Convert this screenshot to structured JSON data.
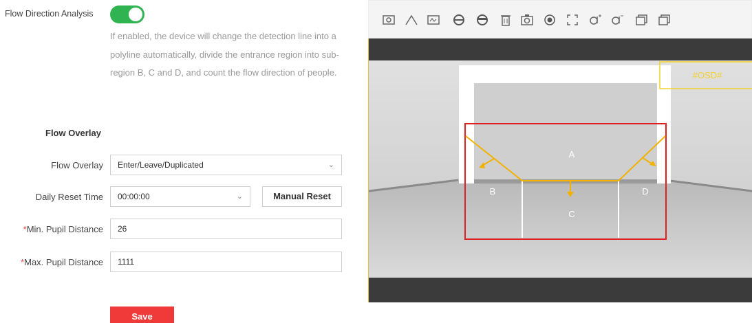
{
  "flow_direction": {
    "label": "Flow Direction Analysis",
    "enabled": true,
    "description": "If enabled, the device will change the detection line into a polyline automatically, divide the entrance region into sub-region B, C and D, and count the flow direction of people."
  },
  "flow_overlay_section": {
    "title": "Flow Overlay"
  },
  "flow_overlay": {
    "label": "Flow Overlay",
    "value": "Enter/Leave/Duplicated"
  },
  "daily_reset": {
    "label": "Daily Reset Time",
    "value": "00:00:00",
    "button": "Manual Reset"
  },
  "min_pupil": {
    "required": "*",
    "label": "Min. Pupil Distance",
    "value": "26"
  },
  "max_pupil": {
    "required": "*",
    "label": "Max. Pupil Distance",
    "value": "1111"
  },
  "save_label": "Save",
  "toolbar": {
    "tools": [
      "snapshot-icon",
      "polyline-icon",
      "region-icon",
      "head-icon",
      "face-icon",
      "delete-icon",
      "camera-icon",
      "record-icon",
      "fullscreen-icon",
      "zoom-in-icon",
      "zoom-out-icon",
      "window-icon",
      "window-alt-icon"
    ]
  },
  "video": {
    "regions": [
      "A",
      "B",
      "C",
      "D"
    ],
    "osd_text": "#OSD#"
  },
  "colors": {
    "toggle_on": "#2fb451",
    "save": "#f03a3a",
    "region_box": "#e02020",
    "arrows": "#f3b200",
    "accent_border": "#e8c230"
  }
}
